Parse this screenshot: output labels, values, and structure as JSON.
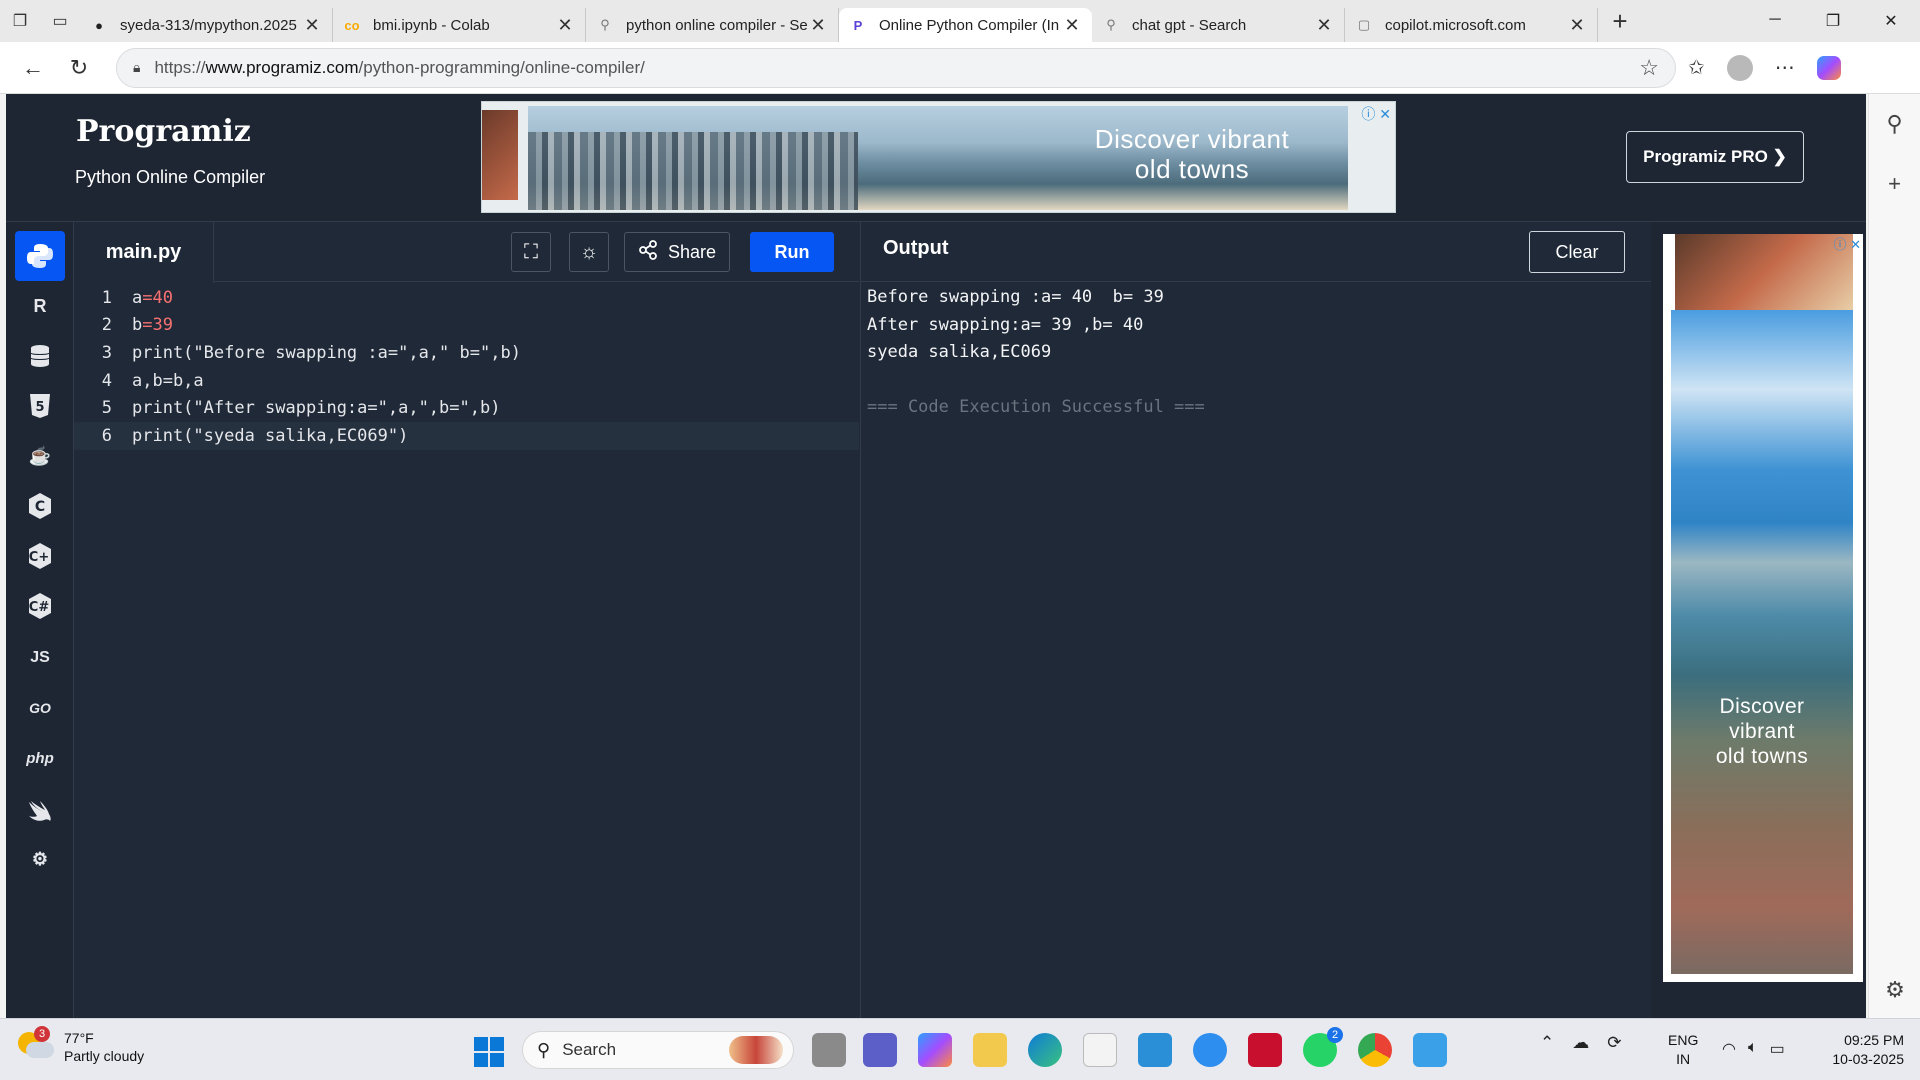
{
  "browser": {
    "tabs": [
      {
        "title": "syeda-313/mypython.2025",
        "icon": "github-icon"
      },
      {
        "title": "bmi.ipynb - Colab",
        "icon": "colab-icon"
      },
      {
        "title": "python online compiler - Se",
        "icon": "search-icon"
      },
      {
        "title": "Online Python Compiler (In",
        "icon": "programiz-icon",
        "active": true
      },
      {
        "title": "chat gpt - Search",
        "icon": "search-icon"
      },
      {
        "title": "copilot.microsoft.com",
        "icon": "page-icon"
      }
    ],
    "url_prefix": "https://",
    "url_domain": "www.programiz.com",
    "url_path": "/python-programming/online-compiler/"
  },
  "header": {
    "logo": "Programiz",
    "subtitle": "Python Online Compiler",
    "pro_button": "Programiz PRO ❯",
    "banner_ad_text_1": "Discover vibrant",
    "banner_ad_text_2": "old towns"
  },
  "rail": {
    "items": [
      "python",
      "r",
      "sql",
      "html",
      "java",
      "c",
      "cpp",
      "csharp",
      "JS",
      "GO",
      "php",
      "swift",
      "rust"
    ]
  },
  "editor": {
    "filename": "main.py",
    "share_label": "Share",
    "run_label": "Run",
    "lines": [
      "a=40",
      "b=39",
      "print(\"Before swapping :a=\",a,\" b=\",b)",
      "a,b=b,a",
      "print(\"After swapping:a=\",a,\",b=\",b)",
      "print(\"syeda salika,EC069\")"
    ]
  },
  "output": {
    "title": "Output",
    "clear_label": "Clear",
    "lines": [
      "Before swapping :a= 40  b= 39",
      "After swapping:a= 39 ,b= 40",
      "syeda salika,EC069",
      "",
      "=== Code Execution Successful ==="
    ]
  },
  "side_ad": {
    "line1": "Discover",
    "line2": "vibrant",
    "line3": "old towns"
  },
  "taskbar": {
    "temp": "77°F",
    "condition": "Partly cloudy",
    "weather_badge": "3",
    "search_placeholder": "Search",
    "lang_1": "ENG",
    "lang_2": "IN",
    "time": "09:25 PM",
    "date": "10-03-2025",
    "whatsapp_badge": "2"
  }
}
